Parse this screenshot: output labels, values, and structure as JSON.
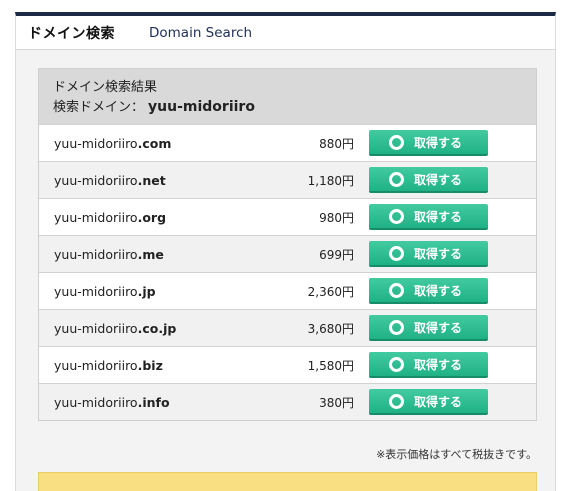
{
  "header": {
    "title_ja": "ドメイン検索",
    "title_en": "Domain Search"
  },
  "result": {
    "heading": "ドメイン検索結果",
    "search_label": "検索ドメイン：",
    "search_domain": "yuu-midoriiro"
  },
  "rows": [
    {
      "base": "yuu-midoriiro",
      "tld": ".com",
      "price": "880円",
      "button": "取得する"
    },
    {
      "base": "yuu-midoriiro",
      "tld": ".net",
      "price": "1,180円",
      "button": "取得する"
    },
    {
      "base": "yuu-midoriiro",
      "tld": ".org",
      "price": "980円",
      "button": "取得する"
    },
    {
      "base": "yuu-midoriiro",
      "tld": ".me",
      "price": "699円",
      "button": "取得する"
    },
    {
      "base": "yuu-midoriiro",
      "tld": ".jp",
      "price": "2,360円",
      "button": "取得する"
    },
    {
      "base": "yuu-midoriiro",
      "tld": ".co.jp",
      "price": "3,680円",
      "button": "取得する"
    },
    {
      "base": "yuu-midoriiro",
      "tld": ".biz",
      "price": "1,580円",
      "button": "取得する"
    },
    {
      "base": "yuu-midoriiro",
      "tld": ".info",
      "price": "380円",
      "button": "取得する"
    }
  ],
  "note": "※表示価格はすべて税抜きです。",
  "colors": {
    "accent_green": "#2fbe90",
    "header_navy": "#1c2a44",
    "notice_yellow": "#f9df82"
  },
  "icons": {
    "button_icon": "ring-icon"
  }
}
